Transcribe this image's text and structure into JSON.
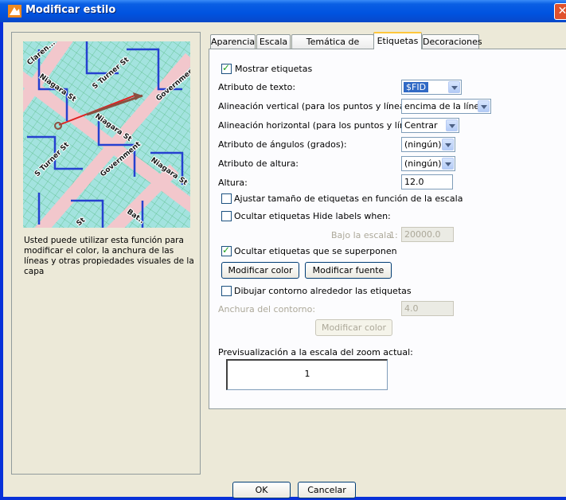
{
  "window": {
    "title": "Modificar estilo",
    "close_label": "✕"
  },
  "left_panel": {
    "map_labels": [
      "Claren...",
      "S Turner St",
      "Niagara St",
      "Government",
      "Niagara St",
      "S Turner St",
      "Government",
      "Niagara St",
      "Bat..",
      "St"
    ],
    "description": "Usted puede utilizar esta función para modificar el color, la anchura de las líneas y otras propiedades visuales de la capa"
  },
  "tabs": [
    "Aparencia",
    "Escala",
    "Temática de colores",
    "Etiquetas",
    "Decoraciones"
  ],
  "active_tab": "Etiquetas",
  "labels_tab": {
    "show_labels": {
      "label": "Mostrar etiquetas",
      "checked": true
    },
    "text_attribute": {
      "label": "Atributo de texto:",
      "value": "$FID"
    },
    "vertical_alignment": {
      "label": "Alineación vertical (para los puntos y líneas):",
      "value": "encima de la línea"
    },
    "horizontal_alignment": {
      "label": "Alineación horizontal (para los puntos y líneas):",
      "value": "Centrar"
    },
    "angle_attribute": {
      "label": "Atributo de ángulos (grados):",
      "value": "(ningún)"
    },
    "height_attribute": {
      "label": "Atributo de altura:",
      "value": "(ningún)"
    },
    "height": {
      "label": "Altura:",
      "value": "12.0"
    },
    "scale_labels": {
      "label": "Ajustar tamaño de etiquetas en función de la escala",
      "checked": false
    },
    "hide_labels": {
      "label": "Ocultar etiquetas Hide labels when:",
      "checked": false
    },
    "below_scale": {
      "label": "Bajo la escala",
      "prefix": "1:",
      "value": "20000.0"
    },
    "hide_overlapping": {
      "label": "Ocultar etiquetas que se superponen",
      "checked": true
    },
    "modify_color_button": "Modificar color",
    "modify_font_button": "Modificar fuente",
    "draw_outline": {
      "label": "Dibujar contorno alrededor las etiquetas",
      "checked": false
    },
    "outline_width": {
      "label": "Anchura del contorno:",
      "value": "4.0"
    },
    "outline_color_button": "Modificar color",
    "preview": {
      "label": "Previsualización a la escala del zoom actual:",
      "value": "1"
    }
  },
  "footer": {
    "ok": "OK",
    "cancel": "Cancelar"
  }
}
